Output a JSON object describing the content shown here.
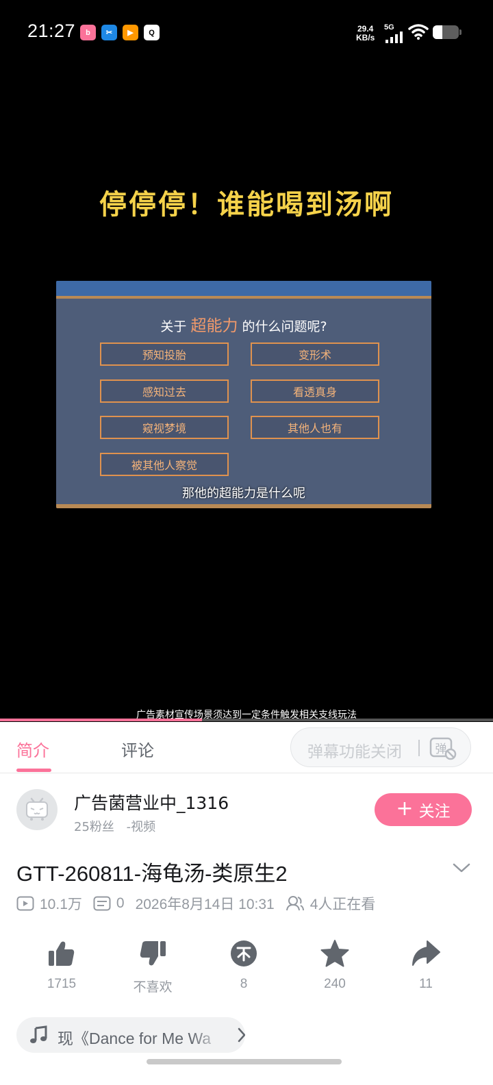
{
  "status_bar": {
    "time": "21:27",
    "net_speed_value": "29.4",
    "net_speed_unit": "KB/s",
    "signal": "5G",
    "app_icons": [
      "bilibili-icon",
      "scissors-app-icon",
      "video-app-icon",
      "qq-icon"
    ],
    "battery_level": 0.38
  },
  "video": {
    "overlay_title": "停停停！谁能喝到汤啊",
    "frame_question_prefix": "关于",
    "frame_question_highlight": "超能力",
    "frame_question_suffix": "的什么问题呢?",
    "options": [
      "预知投胎",
      "变形术",
      "感知过去",
      "看透真身",
      "窥视梦境",
      "其他人也有",
      "被其他人察觉"
    ],
    "subtitle": "那他的超能力是什么呢",
    "notice": "广告素材宣传场景须达到一定条件触发相关支线玩法",
    "progress": 0.41,
    "accent_color": "#fb7299"
  },
  "tabs": {
    "intro": "简介",
    "comments": "评论",
    "danmaku_label": "弹幕功能关闭",
    "danmaku_icon_glyph": "弹"
  },
  "uploader": {
    "name": "广告菌营业中_1316",
    "fans": "25粉丝",
    "meta": "-视频",
    "follow_label": "关注"
  },
  "video_info": {
    "title": "GTT-260811-海龟汤-类原生2",
    "views": "10.1万",
    "danmaku_count": "0",
    "date": "2026年8月14日 10:31",
    "watching": "4人正在看"
  },
  "actions": {
    "like": "1715",
    "dislike": "不喜欢",
    "coin": "8",
    "favorite": "240",
    "share": "11"
  },
  "bgm": {
    "text": "现《Dance for Me Wa"
  }
}
